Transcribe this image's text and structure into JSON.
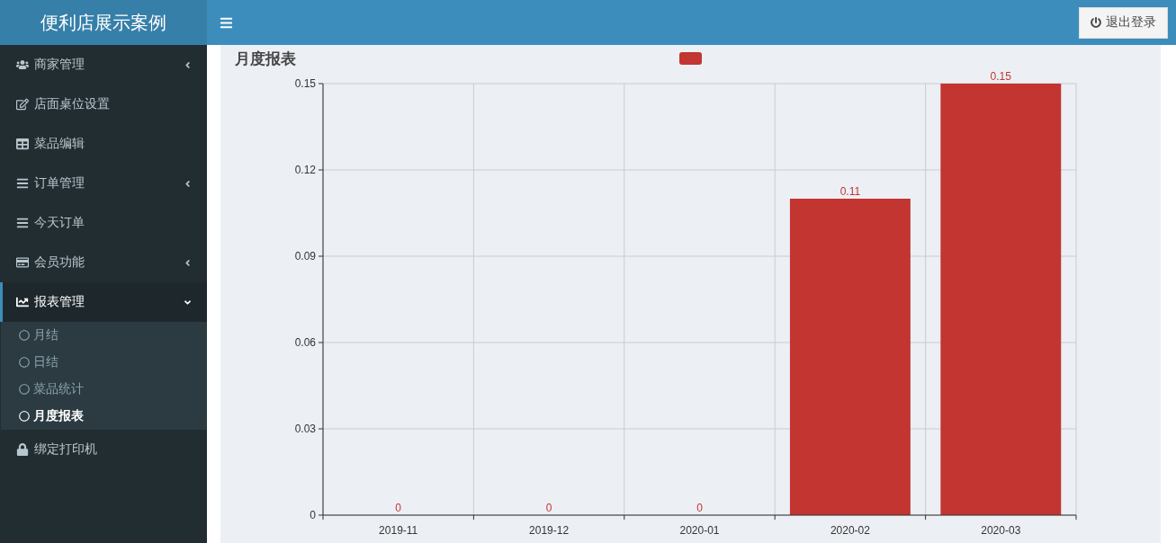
{
  "header": {
    "brand": "便利店展示案例",
    "logout_button": "退出登录"
  },
  "sidebar": {
    "items": [
      {
        "label": "商家管理",
        "kind": "group",
        "expanded": false,
        "selected": false
      },
      {
        "label": "店面桌位设置",
        "kind": "link",
        "selected": false
      },
      {
        "label": "菜品编辑",
        "kind": "link",
        "selected": false
      },
      {
        "label": "订单管理",
        "kind": "group",
        "expanded": false,
        "selected": false
      },
      {
        "label": "今天订单",
        "kind": "link",
        "selected": false
      },
      {
        "label": "会员功能",
        "kind": "group",
        "expanded": false,
        "selected": false
      },
      {
        "label": "报表管理",
        "kind": "group",
        "expanded": true,
        "selected": true,
        "children": [
          {
            "label": "月结",
            "selected": false
          },
          {
            "label": "日结",
            "selected": false
          },
          {
            "label": "菜品统计",
            "selected": false
          },
          {
            "label": "月度报表",
            "selected": true
          }
        ]
      },
      {
        "label": "绑定打印机",
        "kind": "link",
        "selected": false
      }
    ]
  },
  "panel": {
    "title": "月度报表",
    "chart_data": {
      "type": "bar",
      "categories": [
        "2019-11",
        "2019-12",
        "2020-01",
        "2020-02",
        "2020-03"
      ],
      "series": [
        {
          "color": "#c23531",
          "values": [
            0,
            0,
            0,
            0.11,
            0.15
          ]
        }
      ],
      "ylim": [
        0,
        0.15
      ],
      "yticks": [
        0,
        0.03,
        0.06,
        0.09,
        0.12,
        0.15
      ],
      "grid": true,
      "data_labels": true
    }
  }
}
